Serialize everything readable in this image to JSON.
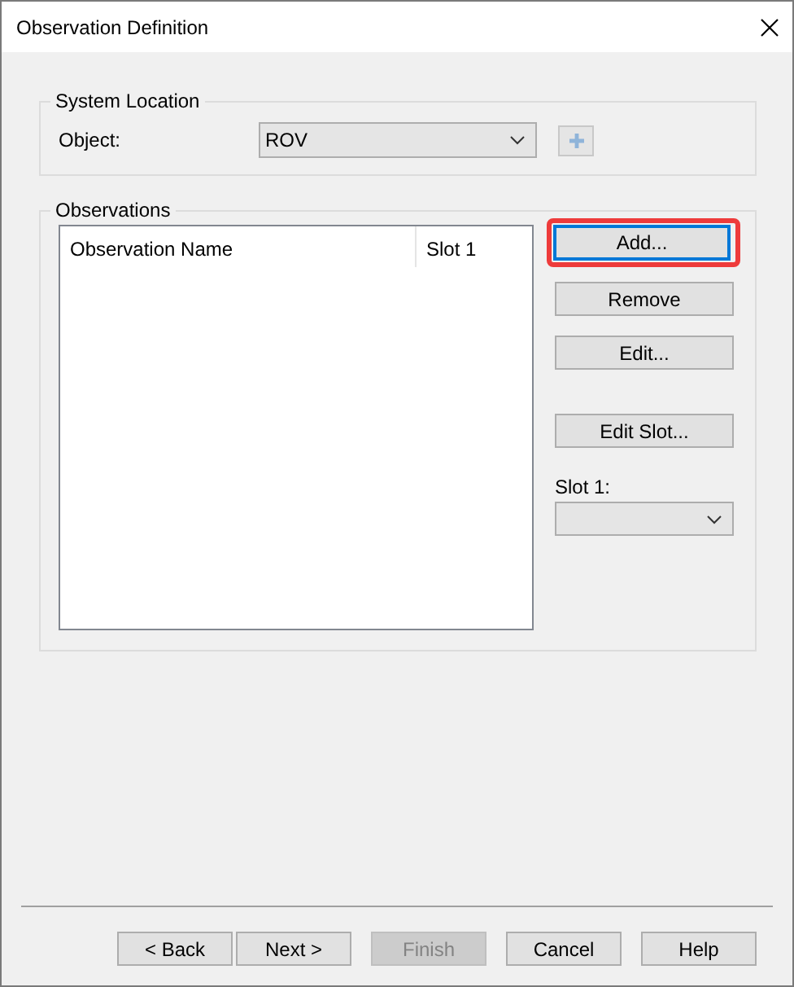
{
  "window": {
    "title": "Observation Definition"
  },
  "system_location": {
    "legend": "System Location",
    "object_label": "Object:",
    "object_value": "ROV",
    "add_object_disabled": true
  },
  "observations": {
    "legend": "Observations",
    "columns": [
      "Observation Name",
      "Slot 1"
    ],
    "buttons": [
      {
        "label": "Add...",
        "highlighted": true
      },
      {
        "label": "Remove",
        "highlighted": false
      },
      {
        "label": "Edit...",
        "highlighted": false
      },
      {
        "label": "Edit Slot...",
        "highlighted": false
      }
    ],
    "slot_label": "Slot 1:"
  },
  "footer_buttons": [
    {
      "label": "< Back",
      "disabled": false
    },
    {
      "label": "Next >",
      "disabled": false
    },
    {
      "label": "Finish",
      "disabled": true
    },
    {
      "label": "Cancel",
      "disabled": false
    },
    {
      "label": "Help",
      "disabled": false
    }
  ]
}
